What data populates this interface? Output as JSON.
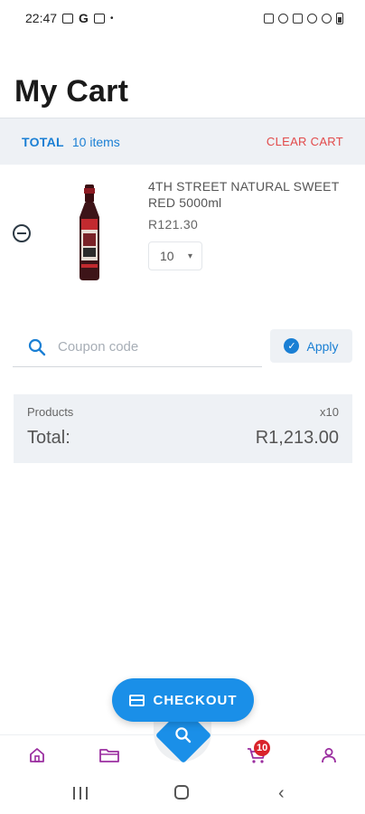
{
  "status_bar": {
    "time": "22:47",
    "g_label": "G",
    "dot": "•"
  },
  "page": {
    "title": "My Cart"
  },
  "cart_summary_bar": {
    "total_label": "TOTAL",
    "item_count": "10 items",
    "clear_label": "CLEAR CART"
  },
  "cart_items": [
    {
      "name": "4TH STREET NATURAL SWEET RED 5000ml",
      "price": "R121.30",
      "quantity": "10"
    }
  ],
  "coupon": {
    "placeholder": "Coupon code",
    "value": "",
    "apply_label": "Apply"
  },
  "summary": {
    "products_label": "Products",
    "products_count": "x10",
    "total_label": "Total:",
    "total_value": "R1,213.00"
  },
  "checkout": {
    "label": "CHECKOUT"
  },
  "bottom_nav": {
    "items": [
      "home-icon",
      "folder-icon",
      "search-icon",
      "cart-icon",
      "user-icon"
    ],
    "cart_badge": "10"
  },
  "colors": {
    "accent": "#1a8fe8",
    "link": "#1a7fd4",
    "danger": "#e24a4a",
    "nav_icon": "#9b2fa0",
    "panel": "#eef1f5"
  }
}
